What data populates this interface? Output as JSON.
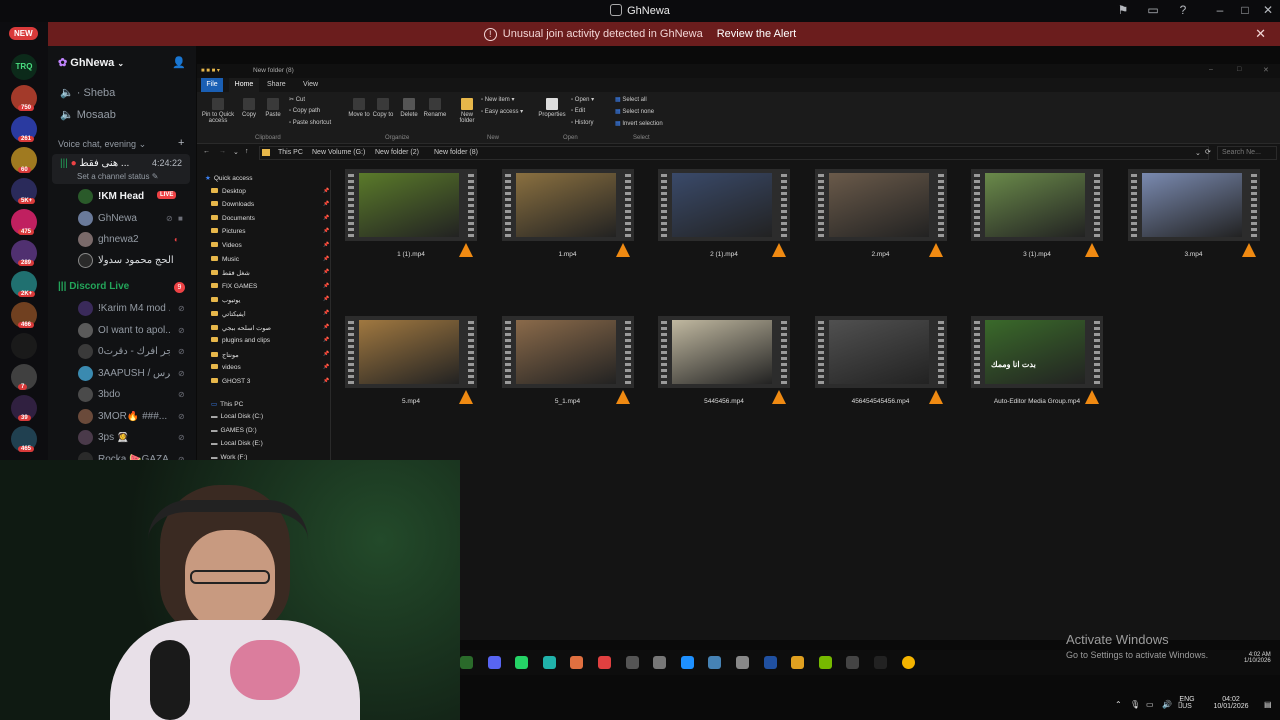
{
  "window": {
    "title": "GhNewa"
  },
  "alert": {
    "text": "Unusual join activity detected in GhNewa",
    "action": "Review the Alert"
  },
  "servers": {
    "new_badge": "NEW",
    "items": [
      {
        "label": "TRQ",
        "color": "#0c2a1a",
        "badge": ""
      },
      {
        "label": "",
        "color": "#a33a2a",
        "badge": "750"
      },
      {
        "label": "",
        "color": "#2a3aa0",
        "badge": "261"
      },
      {
        "label": "",
        "color": "#a07a20",
        "badge": "60"
      },
      {
        "label": "",
        "color": "#2a2a5a",
        "badge": "5K+"
      },
      {
        "label": "",
        "color": "#c02060",
        "badge": "475"
      },
      {
        "label": "",
        "color": "#503070",
        "badge": "289"
      },
      {
        "label": "",
        "color": "#207070",
        "badge": "2K+"
      },
      {
        "label": "",
        "color": "#704020",
        "badge": "466"
      },
      {
        "label": "",
        "color": "#1a1a1a",
        "badge": ""
      },
      {
        "label": "",
        "color": "#404040",
        "badge": "7"
      },
      {
        "label": "",
        "color": "#302040",
        "badge": "39"
      },
      {
        "label": "",
        "color": "#204050",
        "badge": "465"
      }
    ]
  },
  "sidebar": {
    "server_name": "GhNewa",
    "channels": [
      {
        "name": "Sheba"
      },
      {
        "name": "Mosaab"
      }
    ],
    "voice_category": "Voice chat, evening",
    "voice_channel": {
      "name": "هنى فقط ...",
      "timer": "4:24:22",
      "status": "Set a channel status"
    },
    "voice_users": [
      {
        "name": "!KM Head",
        "live": "LIVE"
      },
      {
        "name": "GhNewa",
        "live": ""
      },
      {
        "name": "ghnewa2",
        "live": ""
      },
      {
        "name": "الحج محمود سدولا",
        "live": ""
      }
    ],
    "discord_live": {
      "name": "Discord Live",
      "count": "9"
    },
    "live_users": [
      {
        "name": "!Karim M4 mod ..."
      },
      {
        "name": "OI want to apol..."
      },
      {
        "name": "مسمم جر افرك - دقرت0"
      },
      {
        "name": "3AAPUSH / بو ترس"
      },
      {
        "name": "3bdo"
      },
      {
        "name": "3MOR🔥 ###..."
      },
      {
        "name": "3ps 👩‍🚀"
      },
      {
        "name": "Rocka 🍉GAZA"
      }
    ]
  },
  "explorer": {
    "title": "New folder (8)",
    "tabs": [
      "File",
      "Home",
      "Share",
      "View"
    ],
    "clipboard": {
      "pin": "Pin to Quick access",
      "copy": "Copy",
      "paste": "Paste",
      "cut": "Cut",
      "copy_path": "Copy path",
      "paste_shortcut": "Paste shortcut",
      "group": "Clipboard"
    },
    "organize": {
      "move": "Move to",
      "copy": "Copy to",
      "delete": "Delete",
      "rename": "Rename",
      "group": "Organize"
    },
    "new": {
      "folder": "New folder",
      "item": "New item",
      "easy": "Easy access",
      "group": "New"
    },
    "open": {
      "properties": "Properties",
      "open": "Open",
      "edit": "Edit",
      "history": "History",
      "group": "Open"
    },
    "select": {
      "all": "Select all",
      "none": "Select none",
      "invert": "Invert selection",
      "group": "Select"
    },
    "address": [
      "This PC",
      "New Volume (G:)",
      "New folder (2)",
      "New folder (8)"
    ],
    "search_placeholder": "Search Ne...",
    "nav": [
      {
        "label": "Quick access",
        "type": "star"
      },
      {
        "label": "Desktop",
        "type": "folder"
      },
      {
        "label": "Downloads",
        "type": "folder"
      },
      {
        "label": "Documents",
        "type": "folder"
      },
      {
        "label": "Pictures",
        "type": "folder"
      },
      {
        "label": "Videos",
        "type": "folder"
      },
      {
        "label": "Music",
        "type": "folder"
      },
      {
        "label": "شغل فقط",
        "type": "folder"
      },
      {
        "label": "FIX GAMES",
        "type": "folder"
      },
      {
        "label": "يوتيوب",
        "type": "folder"
      },
      {
        "label": "ايفيكتاتي",
        "type": "folder"
      },
      {
        "label": "صوت اسلحه ببجي",
        "type": "folder"
      },
      {
        "label": "plugins and clips",
        "type": "folder"
      },
      {
        "label": "مونتاج",
        "type": "folder"
      },
      {
        "label": "videos",
        "type": "folder"
      },
      {
        "label": "GHOST 3",
        "type": "folder"
      },
      {
        "label": "This PC",
        "type": "pc"
      },
      {
        "label": "Local Disk (C:)",
        "type": "drive"
      },
      {
        "label": "GAMES (D:)",
        "type": "drive"
      },
      {
        "label": "Local Disk (E:)",
        "type": "drive"
      },
      {
        "label": "Work (F:)",
        "type": "drive"
      }
    ],
    "files": [
      {
        "name": "1 (1).mp4",
        "thumb": "#5a7a2a"
      },
      {
        "name": "1.mp4",
        "thumb": "#8a7040"
      },
      {
        "name": "2 (1).mp4",
        "thumb": "#3a4a6a"
      },
      {
        "name": "2.mp4",
        "thumb": "#6a5a4a"
      },
      {
        "name": "3 (1).mp4",
        "thumb": "#6a8a4a"
      },
      {
        "name": "3.mp4",
        "thumb": "#7a8ab0"
      },
      {
        "name": "5.mp4",
        "thumb": "#a07840"
      },
      {
        "name": "5_1.mp4",
        "thumb": "#8a6a4a"
      },
      {
        "name": "5445456.mp4",
        "thumb": "#c0b8a0"
      },
      {
        "name": "456454545456.mp4",
        "thumb": "#505050"
      },
      {
        "name": "Auto-Editor Media Group.mp4",
        "thumb": "#3a6a2a",
        "overlay": "بدت انا وممك"
      }
    ]
  },
  "watermark": {
    "title": "Activate Windows",
    "sub": "Go to Settings to activate Windows."
  },
  "clock": {
    "time": "4:02 AM",
    "date": "1/10/2026"
  },
  "systray": {
    "lang1": "ENG",
    "lang2": "US",
    "time": "04:02",
    "date": "10/01/2026"
  }
}
